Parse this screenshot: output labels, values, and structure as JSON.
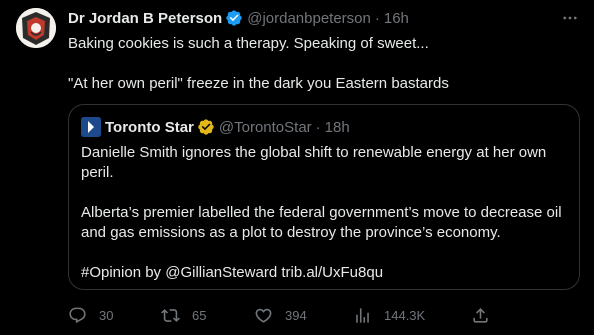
{
  "tweet": {
    "author_name": "Dr Jordan B Peterson",
    "handle": "@jordanbpeterson",
    "separator": "·",
    "time": "16h",
    "text_line1": "Baking cookies is such a therapy. Speaking of sweet...",
    "text_line2": "\"At her own peril\" freeze in the dark you Eastern bastards"
  },
  "quoted": {
    "author_name": "Toronto Star",
    "handle": "@TorontoStar",
    "separator": "·",
    "time": "18h",
    "paragraph1": "Danielle Smith ignores the global shift to renewable energy at her own peril.",
    "paragraph2": "Alberta’s premier labelled the federal government’s move to decrease oil and gas emissions as a plot to destroy the province’s economy.",
    "paragraph3": "#Opinion by @GillianSteward trib.al/UxFu8qu"
  },
  "actions": {
    "replies": "30",
    "retweets": "65",
    "likes": "394",
    "views": "144.3K"
  },
  "colors": {
    "background": "#000000",
    "text_primary": "#e7e9ea",
    "text_secondary": "#71767b",
    "verified_blue": "#1d9bf0",
    "verified_gold": "#e2b719",
    "border": "#2f3336"
  }
}
